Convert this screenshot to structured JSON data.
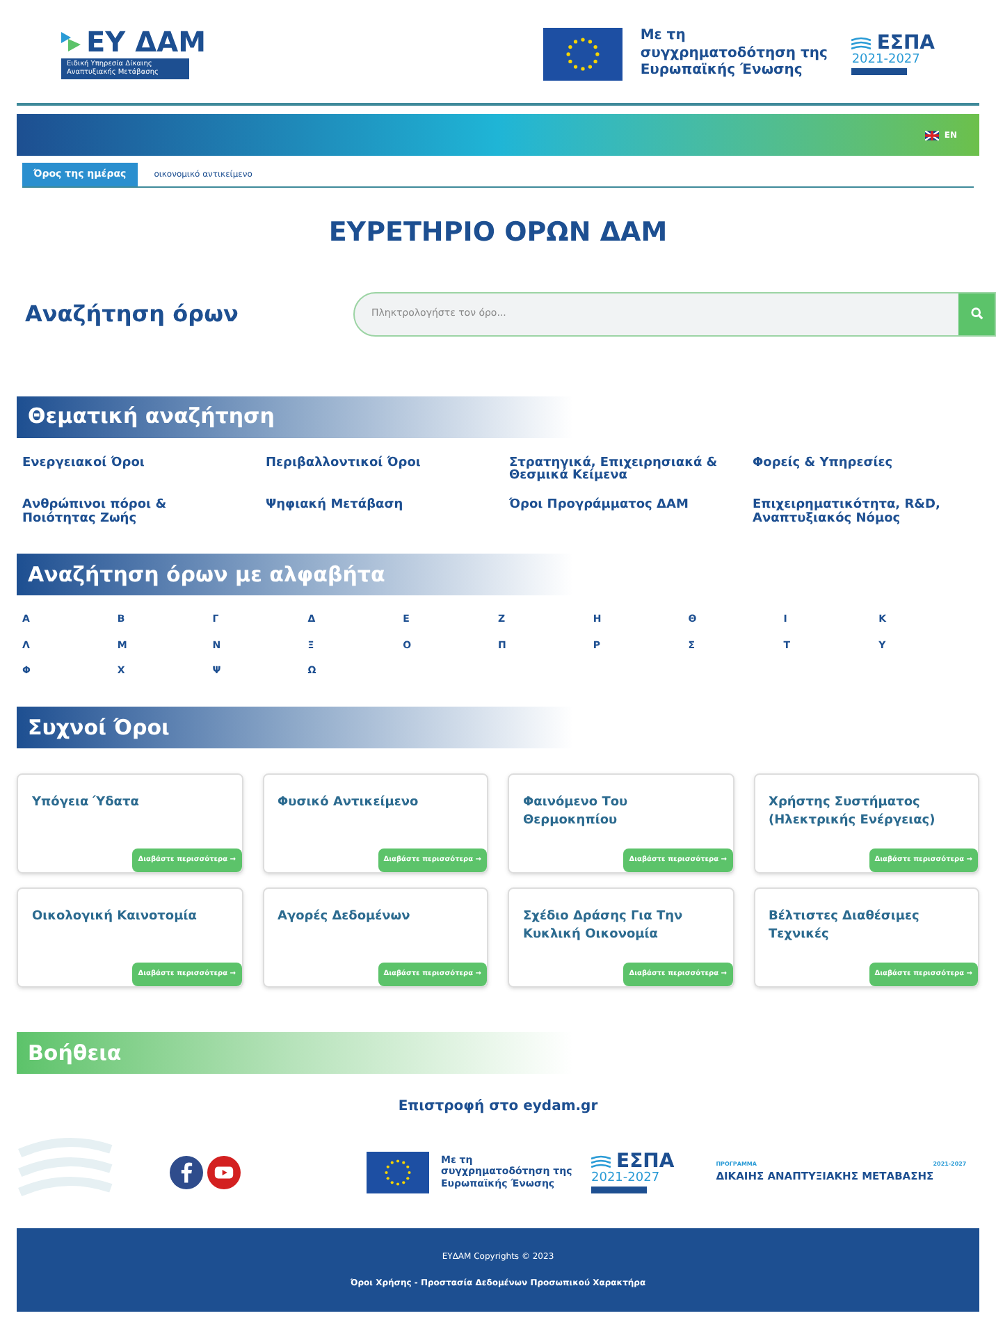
{
  "header": {
    "logo_text": "ΕΥ ΔΑΜ",
    "logo_subtitle": "Ειδική Υπηρεσία Δίκαιης Αναπτυξιακής Μετάβασης",
    "eu_funding": "Με τη συγχρηματοδότηση της Ευρωπαϊκής Ένωσης",
    "espa_title": "ΕΣΠΑ",
    "espa_years": "2021-2027"
  },
  "language": {
    "label": "EN"
  },
  "term_of_day": {
    "label": "Όρος της ημέρας",
    "term": "οικονομικό αντικείμενο"
  },
  "page_title": "ΕΥΡΕΤΗΡΙΟ ΟΡΩΝ ΔΑΜ",
  "search": {
    "title": "Αναζήτηση όρων",
    "placeholder": "Πληκτρολογήστε τον όρο..."
  },
  "thematic": {
    "heading": "Θεματική αναζήτηση",
    "links": [
      "Ενεργειακοί Όροι",
      "Περιβαλλοντικοί Όροι",
      "Στρατηγικά, Επιχειρησιακά & Θεσμικά Κείμενα",
      "Φορείς & Υπηρεσίες",
      "Ανθρώπινοι πόροι & Ποιότητας Ζωής",
      "Ψηφιακή Μετάβαση",
      "Όροι Προγράμματος ΔΑΜ",
      "Επιχειρηματικότητα, R&D, Αναπτυξιακός Νόμος"
    ]
  },
  "alphabet": {
    "heading": "Αναζήτηση όρων με αλφαβήτα",
    "letters": [
      "Α",
      "Β",
      "Γ",
      "Δ",
      "Ε",
      "Ζ",
      "Η",
      "Θ",
      "Ι",
      "Κ",
      "Λ",
      "Μ",
      "Ν",
      "Ξ",
      "Ο",
      "Π",
      "Ρ",
      "Σ",
      "Τ",
      "Υ",
      "Φ",
      "Χ",
      "Ψ",
      "Ω"
    ]
  },
  "frequent": {
    "heading": "Συχνοί Όροι",
    "cards": [
      {
        "title": "Υπόγεια Ύδατα",
        "button": "Διαβάστε περισσότερα →"
      },
      {
        "title": "Φυσικό Αντικείμενο",
        "button": "Διαβάστε περισσότερα →"
      },
      {
        "title": "Φαινόμενο Του Θερμοκηπίου",
        "button": "Διαβάστε περισσότερα →"
      },
      {
        "title": "Χρήστης Συστήματος (Ηλεκτρικής Ενέργειας)",
        "button": "Διαβάστε περισσότερα →"
      },
      {
        "title": "Οικολογική Καινοτομία",
        "button": "Διαβάστε περισσότερα →"
      },
      {
        "title": "Αγορές Δεδομένων",
        "button": "Διαβάστε περισσότερα →"
      },
      {
        "title": "Σχέδιο Δράσης Για Την Κυκλική Οικονομία",
        "button": "Διαβάστε περισσότερα →"
      },
      {
        "title": "Βέλτιστες Διαθέσιμες Τεχνικές",
        "button": "Διαβάστε περισσότερα →"
      }
    ]
  },
  "help": {
    "heading": "Βοήθεια",
    "return_link": "Επιστροφή στο eydam.gr"
  },
  "footer_logos": {
    "eu_funding": "Με τη συγχρηματοδότηση της Ευρωπαϊκής Ένωσης",
    "espa_title": "ΕΣΠΑ",
    "espa_years": "2021-2027",
    "program_label": "ΠΡΟΓΡΑΜΜΑ",
    "program_years": "2021-2027",
    "program_name": "ΔΙΚΑΙΗΣ ΑΝΑΠΤΥΞΙΑΚΗΣ ΜΕΤΑΒΑΣΗΣ"
  },
  "footer": {
    "copyright": "ΕΥΔΑΜ Copyrights © 2023",
    "links": "Όροι Χρήσης - Προστασία Δεδομένων Προσωπικού Χαρακτήρα"
  }
}
